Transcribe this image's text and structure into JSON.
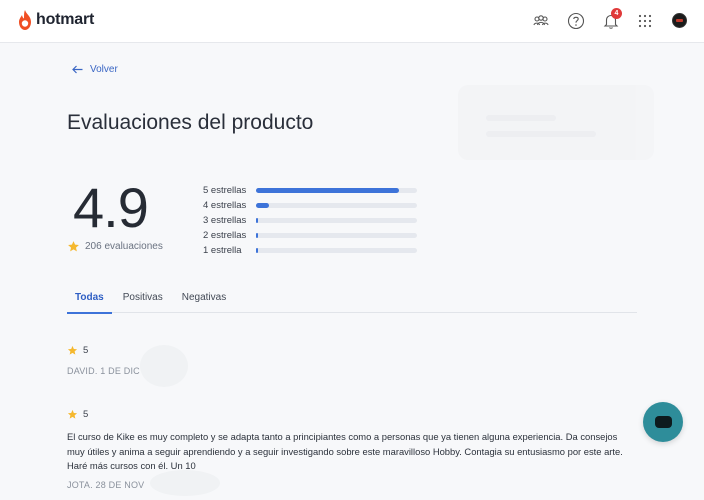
{
  "app": {
    "brand": "hotmart"
  },
  "header": {
    "icons": [
      "community-icon",
      "help-icon",
      "bell-icon",
      "apps-grid-icon",
      "avatar"
    ],
    "notification_count": "4"
  },
  "nav": {
    "back_label": "Volver"
  },
  "page": {
    "title": "Evaluaciones del producto"
  },
  "summary": {
    "score": "4.9",
    "count_label": "206 evaluaciones",
    "distribution": [
      {
        "label": "5 estrellas",
        "fill": 0.89
      },
      {
        "label": "4 estrellas",
        "fill": 0.08
      },
      {
        "label": "3 estrellas",
        "fill": 0.01
      },
      {
        "label": "2 estrellas",
        "fill": 0.01
      },
      {
        "label": "1 estrella",
        "fill": 0.01
      }
    ]
  },
  "tabs": [
    {
      "label": "Todas",
      "active": true
    },
    {
      "label": "Positivas",
      "active": false
    },
    {
      "label": "Negativas",
      "active": false
    }
  ],
  "reviews": [
    {
      "rating": "5",
      "text": "",
      "meta": "DAVID. 1 DE DIC"
    },
    {
      "rating": "5",
      "text": "El curso de Kike es muy completo y se adapta tanto a principiantes como a personas que ya tienen alguna experiencia. Da consejos muy útiles y anima a seguir aprendiendo y a seguir investigando sobre este maravilloso Hobby. Contagia su entusiasmo por este arte. Haré más cursos con él. Un 10",
      "meta": "JOTA. 28 DE NOV"
    }
  ],
  "colors": {
    "accent": "#3d73d9",
    "brand": "#f04e23",
    "star": "#f5b82e",
    "chat": "#2e8d9a"
  }
}
